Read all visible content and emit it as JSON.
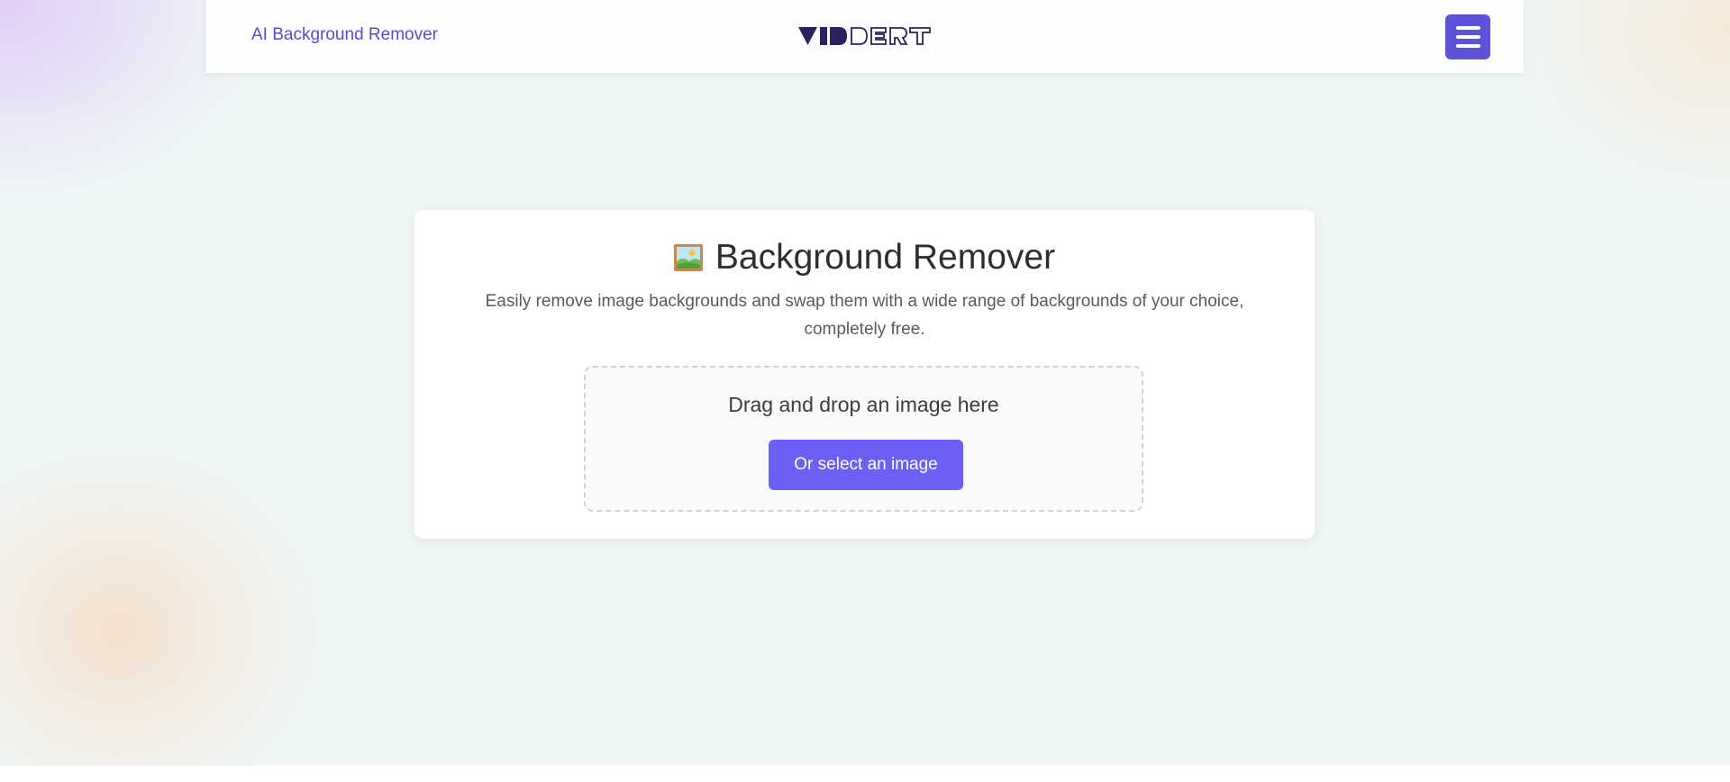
{
  "header": {
    "brand_link": "AI Background Remover",
    "logo_alt": "VIDDERT",
    "menu_icon": "hamburger-menu-icon",
    "accent_color": "#5e52d9"
  },
  "main": {
    "title_icon": "framed-picture-icon",
    "title": "Background Remover",
    "description": "Easily remove image backgrounds and swap them with a wide range of backgrounds of your choice, completely free.",
    "dropzone": {
      "prompt": "Drag and drop an image here",
      "select_button": "Or select an image",
      "button_color": "#6c5ff4"
    }
  }
}
